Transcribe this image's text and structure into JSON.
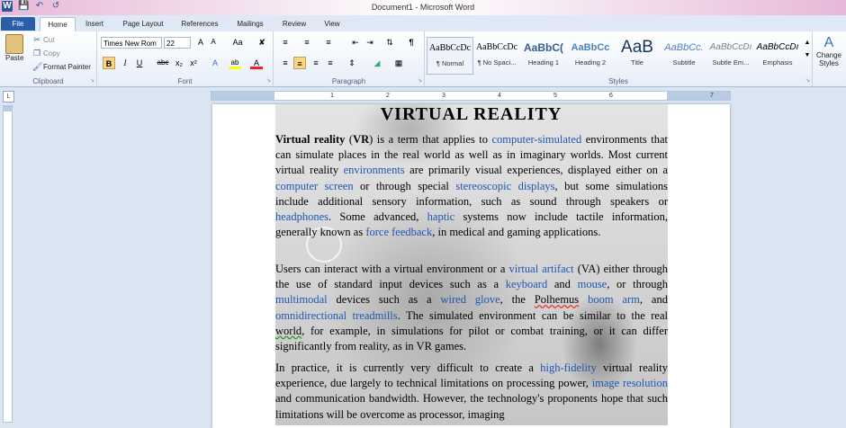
{
  "window": {
    "title": "Document1 - Microsoft Word",
    "qat_icons": [
      "word-logo-icon",
      "save-icon",
      "undo-icon",
      "redo-icon"
    ]
  },
  "tabs": [
    "File",
    "Home",
    "Insert",
    "Page Layout",
    "References",
    "Mailings",
    "Review",
    "View"
  ],
  "active_tab": "Home",
  "clipboard": {
    "paste": "Paste",
    "cut": "Cut",
    "copy": "Copy",
    "format_painter": "Format Painter",
    "label": "Clipboard"
  },
  "font": {
    "name": "Times New Rom",
    "size": "22",
    "label": "Font",
    "grow": "A",
    "shrink": "A",
    "case": "Aa",
    "bold": "B",
    "italic": "I",
    "underline": "U",
    "strike": "abc",
    "subscript": "x₂",
    "superscript": "x²",
    "effects": "A",
    "highlight": "ab",
    "color": "A"
  },
  "paragraph": {
    "label": "Paragraph"
  },
  "styles": {
    "label": "Styles",
    "items": [
      {
        "preview": "AaBbCcDc",
        "name": "¶ Normal"
      },
      {
        "preview": "AaBbCcDc",
        "name": "¶ No Spaci..."
      },
      {
        "preview": "AaBbC(",
        "name": "Heading 1"
      },
      {
        "preview": "AaBbCc",
        "name": "Heading 2"
      },
      {
        "preview": "AaB",
        "name": "Title"
      },
      {
        "preview": "AaBbCc.",
        "name": "Subtitle"
      },
      {
        "preview": "AaBbCcDı",
        "name": "Subtle Em..."
      },
      {
        "preview": "AaBbCcDı",
        "name": "Emphasis"
      }
    ],
    "change_styles": "Change Styles"
  },
  "ruler": {
    "corner": "L",
    "numbers": [
      "1",
      "2",
      "3",
      "4",
      "5",
      "6",
      "7"
    ]
  },
  "document": {
    "title": "VIRTUAL REALITY",
    "p1": {
      "term": "Virtual reality",
      "abbr": "VR",
      "t1": " is a term that applies to ",
      "l1": "computer-simulated",
      "t2": " environments that can simulate places in the real world as well as in imaginary worlds. Most current virtual reality ",
      "l2": "environments",
      "t3": " are primarily visual experiences, displayed either on a ",
      "l3": "computer screen",
      "t4": " or through special ",
      "l4": "stereoscopic displays",
      "t5": ", but some simulations include additional sensory information, such as sound through speakers or ",
      "l5": "headphones",
      "t6": ". Some advanced, ",
      "l6": "haptic",
      "t7": " systems now include tactile information, generally known as ",
      "l7": "force feedback",
      "t8": ", in medical and gaming applications."
    },
    "p2": {
      "t1": "Users can interact with a virtual environment or a ",
      "l1": "virtual artifact",
      "t2": " (VA) either through the use of standard input devices such as a ",
      "l2": "keyboard",
      "t3": " and ",
      "l3": "mouse",
      "t4": ", or through ",
      "l4": "multimodal",
      "t5": " devices such as a ",
      "l5": "wired glove",
      "t6": ", the ",
      "sq1": "Polhemus",
      "t7": " ",
      "l6": "boom arm",
      "t8": ", and ",
      "l7": "omnidirectional treadmills",
      "t9": ". The simulated environment can be similar to the real ",
      "sq2": "world",
      "t10": ", for example, in simulations for pilot or combat training, or it can differ significantly from reality, as in VR games."
    },
    "p3": {
      "t1": "In practice, it is currently very difficult to create a ",
      "l1": "high-fidelity",
      "t2": " virtual reality experience, due largely to technical limitations on processing power, ",
      "l2": "image resolution",
      "t3": " and communication bandwidth. However, the technology's proponents hope that such limitations will be overcome as processor, imaging"
    }
  }
}
